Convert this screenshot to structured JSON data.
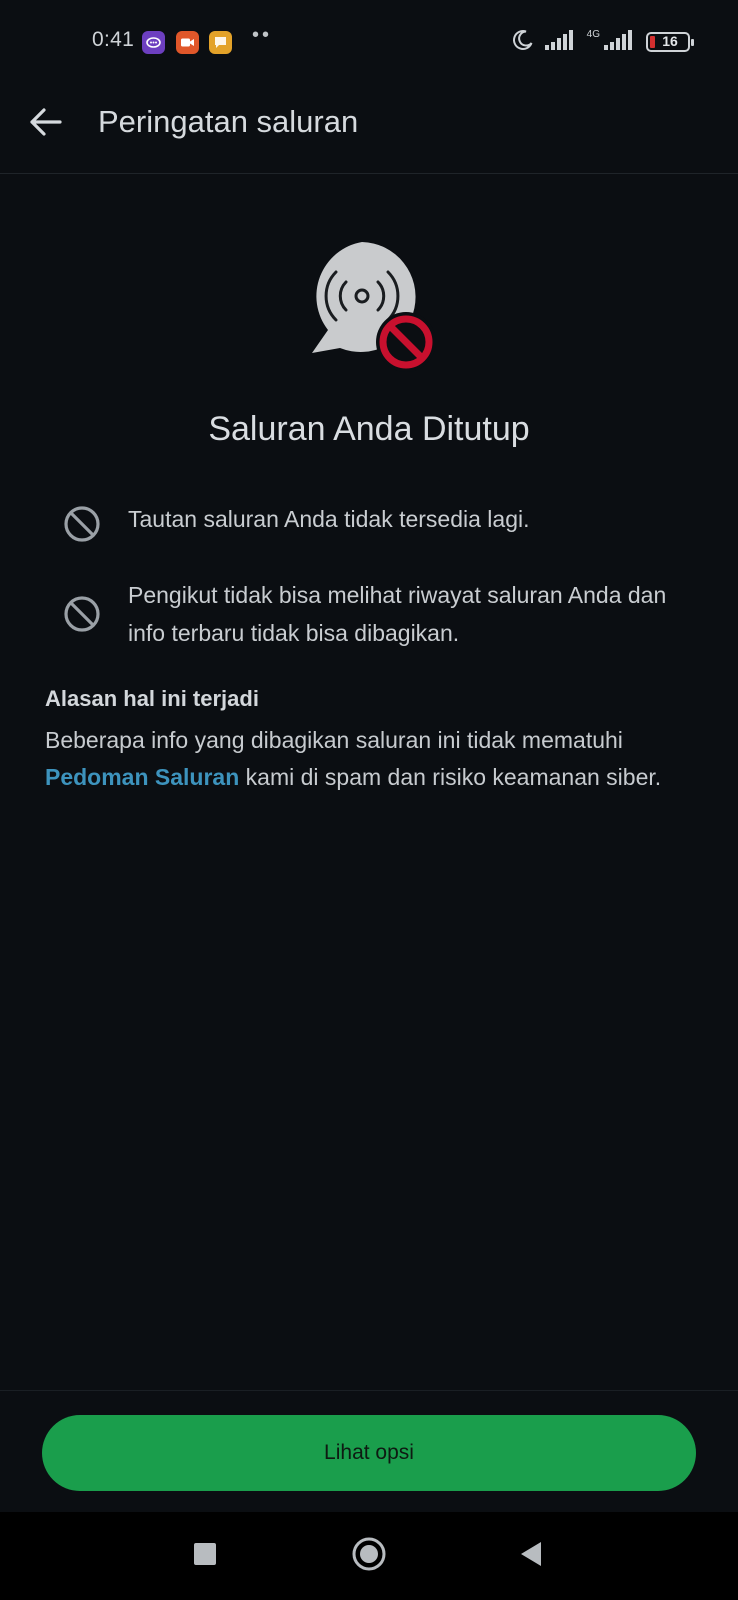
{
  "status_bar": {
    "time": "0:41",
    "network_label": "4G",
    "battery_level": "16",
    "icons": [
      "messenger-app-icon",
      "video-app-icon",
      "chat-app-icon",
      "more-notifications-icon",
      "moon-icon",
      "signal-icon",
      "signal-4g-icon",
      "battery-icon"
    ]
  },
  "app_bar": {
    "title": "Peringatan saluran",
    "back_icon": "arrow-back-icon"
  },
  "hero": {
    "icon": "channel-closed-icon",
    "headline": "Saluran Anda Ditutup"
  },
  "info_items": [
    {
      "icon": "block-icon",
      "text": "Tautan saluran Anda tidak tersedia lagi."
    },
    {
      "icon": "block-icon",
      "text": "Pengikut tidak bisa melihat riwayat saluran Anda dan info terbaru tidak bisa dibagikan."
    }
  ],
  "reason": {
    "title": "Alasan hal ini terjadi",
    "text_before": "Beberapa info yang dibagikan saluran ini tidak mematuhi ",
    "link_text": "Pedoman Saluran",
    "text_after": " kami di spam dan risiko keamanan siber."
  },
  "actions": {
    "primary_label": "Lihat opsi"
  },
  "nav_bar": {
    "buttons": [
      "recents-square-icon",
      "home-circle-icon",
      "back-triangle-icon"
    ]
  },
  "colors": {
    "background": "#0b0e12",
    "accent_green": "#1a9e4c",
    "link_blue": "#3d93bd",
    "danger_red": "#c8102e"
  }
}
